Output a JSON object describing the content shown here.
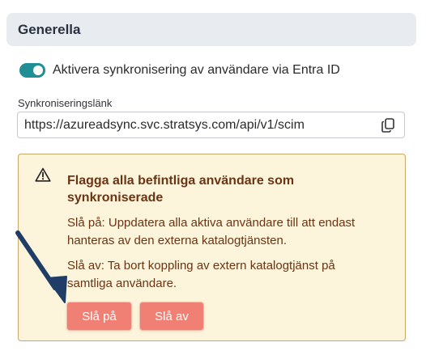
{
  "section": {
    "title": "Generella"
  },
  "sync": {
    "toggle_label": "Aktivera synkronisering av användare via Entra ID",
    "toggle_on": true
  },
  "link": {
    "label": "Synkroniseringslänk",
    "value": "https://azureadsync.svc.stratsys.com/api/v1/scim",
    "copy_icon": "copy-icon"
  },
  "warning": {
    "icon": "warning-triangle-icon",
    "title": "Flagga alla befintliga användare som synkroniserade",
    "on_text": "Slå på: Uppdatera alla aktiva användare till att endast hanteras av den externa katalogtjänsten.",
    "off_text": "Slå av: Ta bort koppling av extern katalogtjänst på samtliga användare.",
    "on_button": "Slå på",
    "off_button": "Slå av"
  },
  "colors": {
    "accent": "#1f8e95",
    "warning_bg": "#fdf4dc",
    "warning_text": "#6b3412",
    "button": "#f07f74",
    "arrow": "#1f3d66"
  }
}
